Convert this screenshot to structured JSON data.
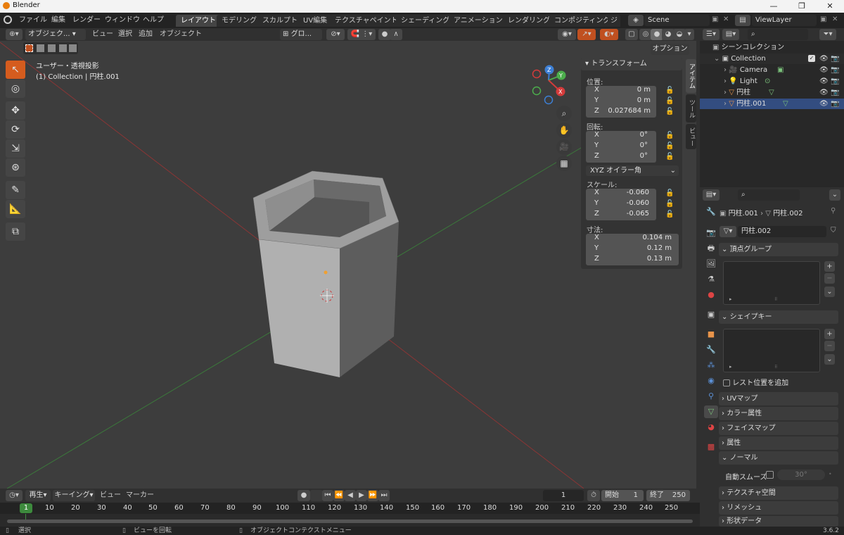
{
  "app": {
    "title": "Blender",
    "version": "3.6.2"
  },
  "menu": [
    "ファイル",
    "編集",
    "レンダー",
    "ウィンドウ",
    "ヘルプ"
  ],
  "workspaces": [
    "レイアウト",
    "モデリング",
    "スカルプト",
    "UV編集",
    "テクスチャペイント",
    "シェーディング",
    "アニメーション",
    "レンダリング",
    "コンポジティング",
    "ジ"
  ],
  "scene": "Scene",
  "view_layer": "ViewLayer",
  "viewport": {
    "mode": "オブジェク...",
    "menus": [
      "ビュー",
      "選択",
      "追加",
      "オブジェクト"
    ],
    "transform": "グロ...",
    "options": "オプション",
    "overlay_line1": "ユーザー・透視投影",
    "overlay_line2": "(1) Collection | 円柱.001"
  },
  "gizmo": {
    "x": "X",
    "y": "Y",
    "z": "Z"
  },
  "npanel": {
    "tabs": [
      "アイテム",
      "ツール",
      "ビュー"
    ],
    "header": "トランスフォーム",
    "location_label": "位置:",
    "location": [
      {
        "axis": "X",
        "value": "0 m"
      },
      {
        "axis": "Y",
        "value": "0 m"
      },
      {
        "axis": "Z",
        "value": "0.027684 m"
      }
    ],
    "rotation_label": "回転:",
    "rotation": [
      {
        "axis": "X",
        "value": "0°"
      },
      {
        "axis": "Y",
        "value": "0°"
      },
      {
        "axis": "Z",
        "value": "0°"
      }
    ],
    "rotation_mode": "XYZ オイラー角",
    "scale_label": "スケール:",
    "scale": [
      {
        "axis": "X",
        "value": "-0.060"
      },
      {
        "axis": "Y",
        "value": "-0.060"
      },
      {
        "axis": "Z",
        "value": "-0.065"
      }
    ],
    "dimensions_label": "寸法:",
    "dimensions": [
      {
        "axis": "X",
        "value": "0.104 m"
      },
      {
        "axis": "Y",
        "value": "0.12 m"
      },
      {
        "axis": "Z",
        "value": "0.13 m"
      }
    ]
  },
  "outliner": {
    "root": "シーンコレクション",
    "collection": "Collection",
    "items": [
      "Camera",
      "Light",
      "円柱",
      "円柱.001"
    ]
  },
  "properties": {
    "breadcrumb_object": "円柱.001",
    "breadcrumb_data": "円柱.002",
    "mesh_name": "円柱.002",
    "panels": {
      "vertex_groups": "頂点グループ",
      "shape_keys": "シェイプキー",
      "rest_position": "レスト位置を追加",
      "uv_maps": "UVマップ",
      "color_attributes": "カラー属性",
      "face_maps": "フェイスマップ",
      "attributes": "属性",
      "normals": "ノーマル",
      "auto_smooth": "自動スムーズ",
      "auto_smooth_angle": "30°",
      "texture_space": "テクスチャ空間",
      "remesh": "リメッシュ",
      "geometry_data": "形状データ"
    }
  },
  "timeline": {
    "playback": "再生",
    "keying": "キーイング",
    "view": "ビュー",
    "marker": "マーカー",
    "current_frame": "1",
    "start_label": "開始",
    "start": "1",
    "end_label": "終了",
    "end": "250",
    "ticks": [
      "1",
      "10",
      "20",
      "30",
      "40",
      "50",
      "60",
      "70",
      "80",
      "90",
      "100",
      "110",
      "120",
      "130",
      "140",
      "150",
      "160",
      "170",
      "180",
      "190",
      "200",
      "210",
      "220",
      "230",
      "240",
      "250"
    ]
  },
  "status": {
    "select": "選択",
    "rotate": "ビューを回転",
    "context": "オブジェクトコンテクストメニュー"
  },
  "colors": {
    "accent": "#d55c1e",
    "active_ws": "#444444",
    "x_axis": "#d43b3b",
    "y_axis": "#4cae4c",
    "z_axis": "#3d7fd4"
  }
}
